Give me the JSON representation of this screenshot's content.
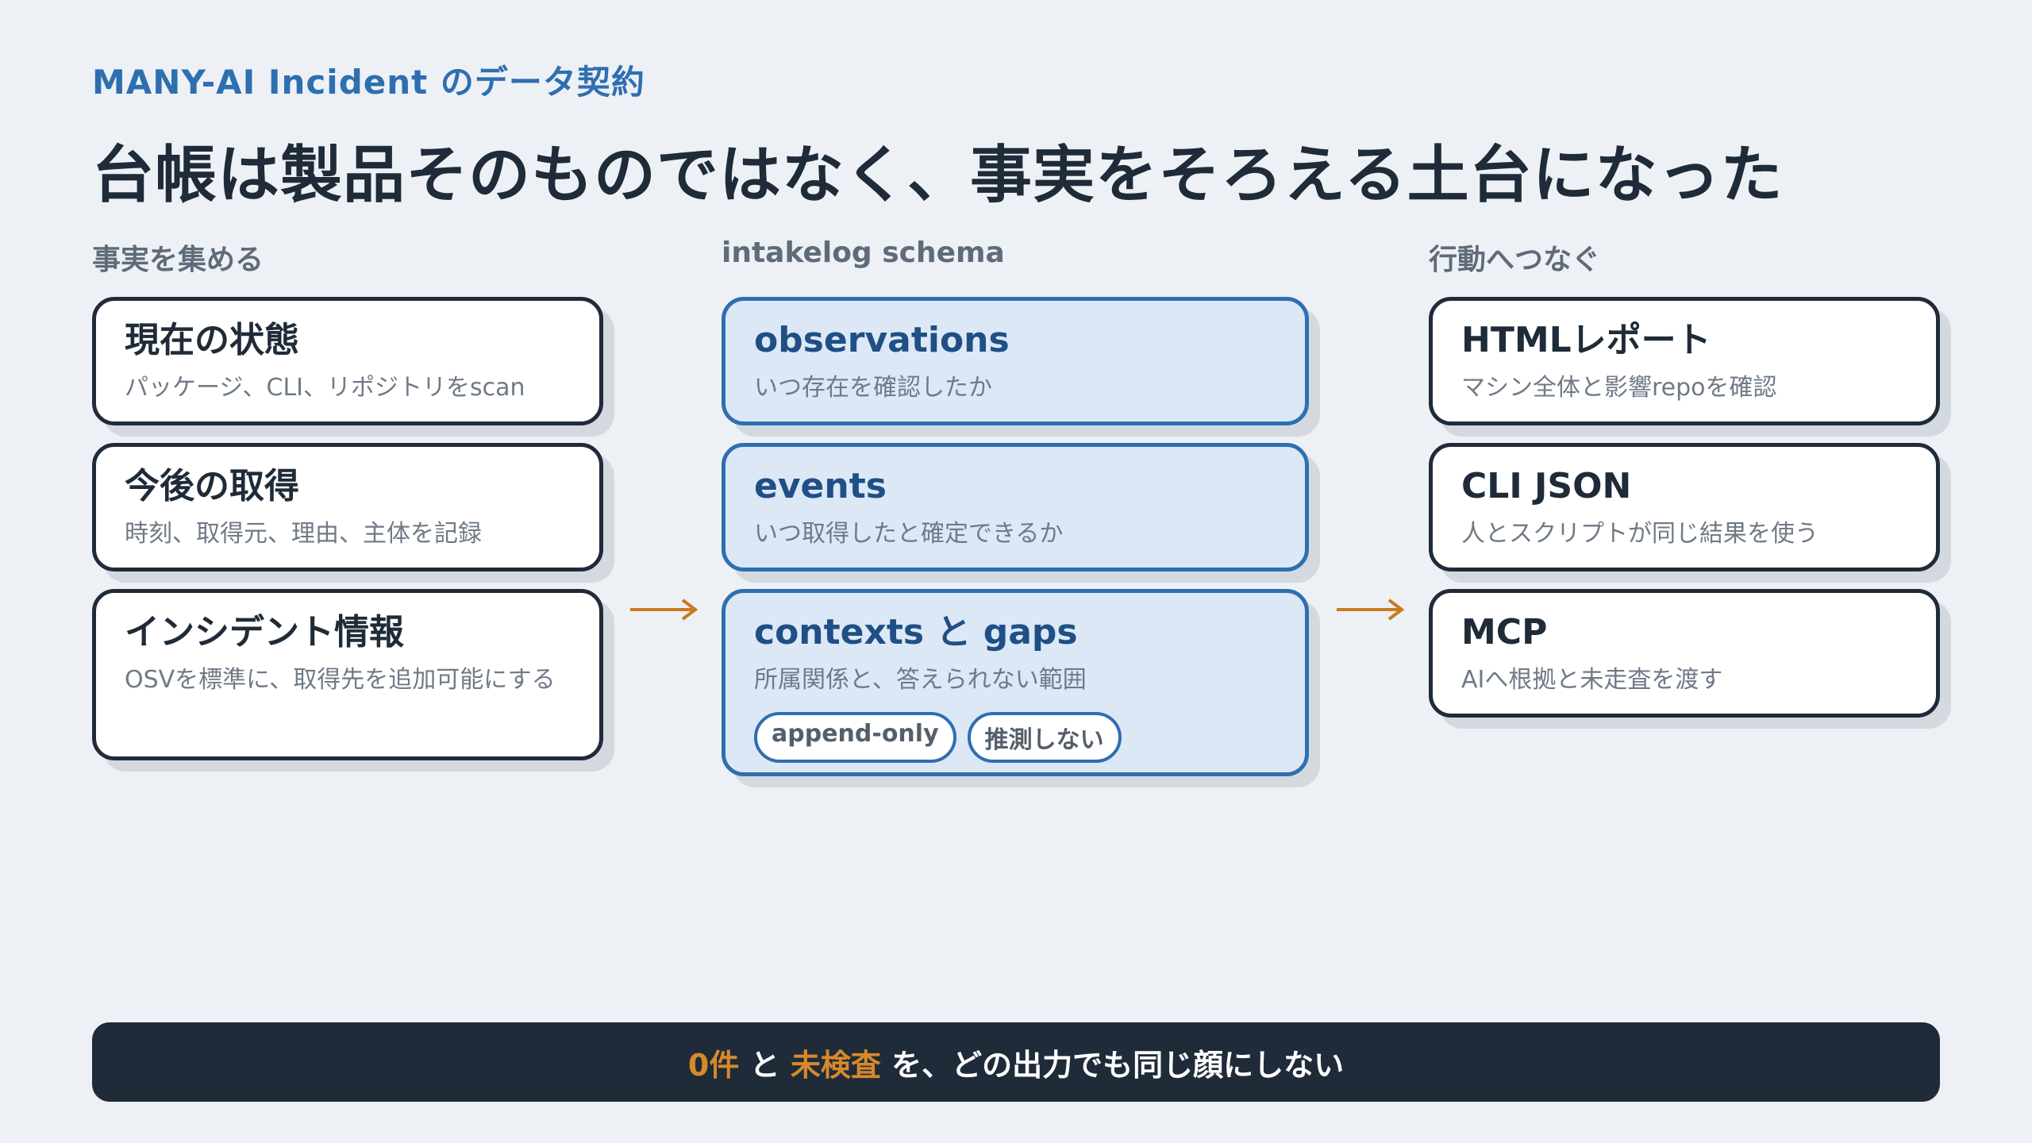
{
  "kicker": "MANY-AI Incident のデータ契約",
  "headline": "台帳は製品そのものではなく、事実をそろえる土台になった",
  "columns": [
    {
      "label": "事実を集める",
      "cards": [
        {
          "title": "現在の状態",
          "desc": "パッケージ、CLI、リポジトリをscan"
        },
        {
          "title": "今後の取得",
          "desc": "時刻、取得元、理由、主体を記録"
        },
        {
          "title": "インシデント情報",
          "desc": "OSVを標準に、取得先を追加可能にする"
        }
      ]
    },
    {
      "label": "intakelog schema",
      "cards": [
        {
          "title": "observations",
          "desc": "いつ存在を確認したか"
        },
        {
          "title": "events",
          "desc": "いつ取得したと確定できるか"
        },
        {
          "title": "contexts と gaps",
          "desc": "所属関係と、答えられない範囲",
          "pills": [
            "append-only",
            "推測しない"
          ]
        }
      ]
    },
    {
      "label": "行動へつなぐ",
      "cards": [
        {
          "title": "HTMLレポート",
          "desc": "マシン全体と影響repoを確認"
        },
        {
          "title": "CLI JSON",
          "desc": "人とスクリプトが同じ結果を使う"
        },
        {
          "title": "MCP",
          "desc": "AIへ根拠と未走査を渡す"
        }
      ]
    }
  ],
  "footer": {
    "highlight_1": "0件",
    "connector": " と ",
    "highlight_2": "未検査",
    "rest": " を、どの出力でも同じ顔にしない"
  },
  "colors": {
    "accent_blue": "#2e6fb0",
    "accent_orange": "#d7892c",
    "dark": "#1f2b38",
    "background": "#edf1f6"
  },
  "icons": [
    "arrow-right-icon",
    "arrow-right-icon"
  ]
}
